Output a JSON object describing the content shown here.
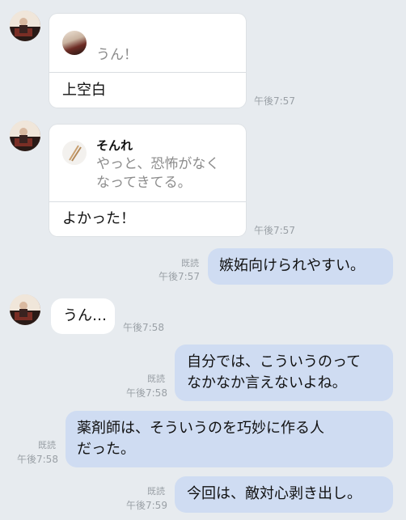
{
  "messages": [
    {
      "quote_text": "うん！",
      "text": "上空白",
      "time": "午後7:57"
    },
    {
      "quote_name": "そんれ",
      "quote_text": "やっと、恐怖がなく\nなってきてる。",
      "text": "よかった！",
      "time": "午後7:57"
    },
    {
      "read": "既読",
      "text": "嫉妬向けられやすい。",
      "time": "午後7:57"
    },
    {
      "text": "うん…",
      "time": "午後7:58"
    },
    {
      "read": "既読",
      "text": "自分では、こういうのって\nなかなか言えないよね。",
      "time": "午後7:58"
    },
    {
      "read": "既読",
      "text": "薬剤師は、そういうのを巧妙に作る人\nだった。",
      "time": "午後7:58"
    },
    {
      "read": "既読",
      "text": "今回は、敵対心剥き出し。",
      "time": "午後7:59"
    }
  ],
  "colors": {
    "background": "#e7ebef",
    "incoming": "#ffffff",
    "outgoing": "#cfdcf2",
    "meta": "#9aa0a6"
  }
}
